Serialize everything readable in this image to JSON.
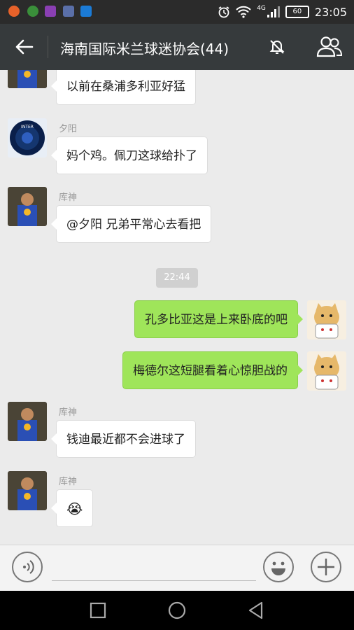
{
  "status_bar": {
    "network": "4G",
    "battery": "60",
    "time": "23:05"
  },
  "header": {
    "title": "海南国际米兰球迷协会(44)"
  },
  "messages": [
    {
      "side": "left",
      "sender": "",
      "avatar": "curry-avatar",
      "text": "以前在桑浦多利亚好猛"
    },
    {
      "side": "left",
      "sender": "夕阳",
      "avatar": "inter-avatar",
      "text": "妈个鸡。佩刀这球给扑了"
    },
    {
      "side": "left",
      "sender": "库神",
      "avatar": "curry-avatar",
      "text": "@夕阳 兄弟平常心去看把"
    },
    {
      "side": "right",
      "sender": "",
      "avatar": "doge-avatar",
      "text": "孔多比亚这是上来卧底的吧"
    },
    {
      "side": "right",
      "sender": "",
      "avatar": "doge-avatar",
      "text": "梅德尔这短腿看着心惊胆战的"
    },
    {
      "side": "left",
      "sender": "库神",
      "avatar": "curry-avatar",
      "text": "钱迪最近都不会进球了"
    },
    {
      "side": "left",
      "sender": "库神",
      "avatar": "curry-avatar",
      "text": "😭"
    }
  ],
  "timestamp": "22:44",
  "colors": {
    "title_bar": "#363a3c",
    "status_bar": "#2b2b2b",
    "chat_bg": "#ebebeb",
    "own_bubble": "#9fe55a",
    "other_bubble": "#ffffff"
  }
}
